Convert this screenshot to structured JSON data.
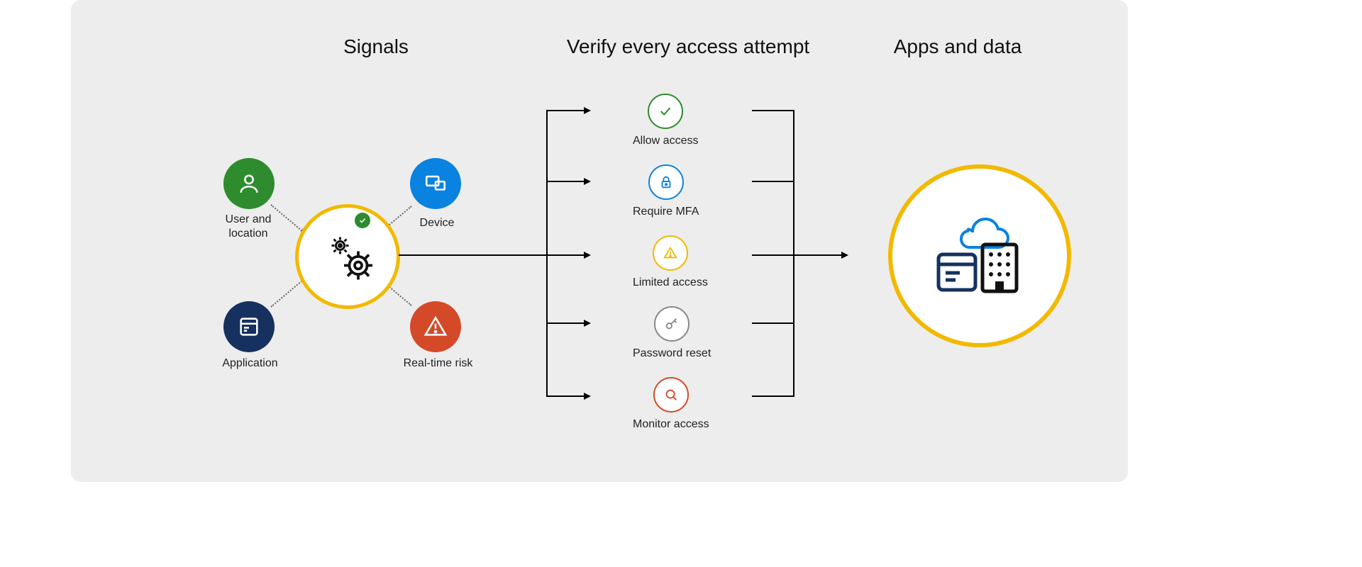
{
  "headers": {
    "signals": "Signals",
    "verify": "Verify every access attempt",
    "apps": "Apps and data"
  },
  "signals": {
    "user": "User and location",
    "device": "Device",
    "application": "Application",
    "risk": "Real-time risk"
  },
  "verify": [
    {
      "label": "Allow access",
      "icon": "check-icon",
      "color": "#2e8b2e"
    },
    {
      "label": "Require MFA",
      "icon": "lock-icon",
      "color": "#0a82e0"
    },
    {
      "label": "Limited access",
      "icon": "warning-icon",
      "color": "#f2b900"
    },
    {
      "label": "Password reset",
      "icon": "key-icon",
      "color": "#888888"
    },
    {
      "label": "Monitor access",
      "icon": "search-icon",
      "color": "#d44a29"
    }
  ],
  "hub": {
    "icon": "gears-icon",
    "badge_icon": "check-icon"
  },
  "apps": {
    "icon": "apps-cloud-building-icon"
  },
  "colors": {
    "accent_yellow": "#f2b900",
    "green": "#2e8b2e",
    "blue": "#0a82e0",
    "navy": "#16315f",
    "orange": "#d44a29",
    "bg": "#ededed"
  }
}
